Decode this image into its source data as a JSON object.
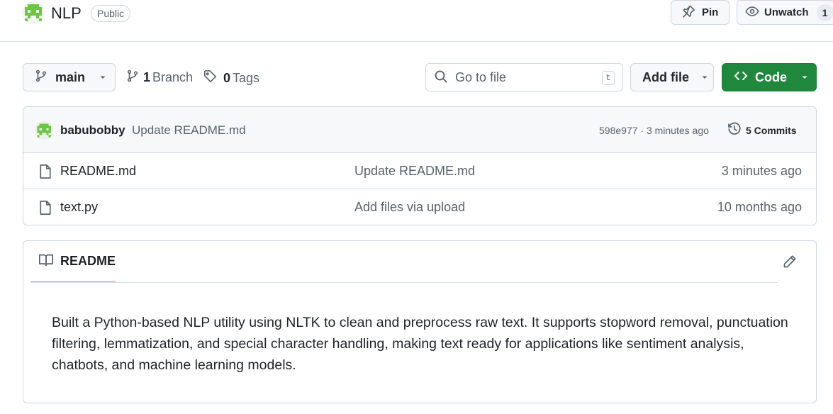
{
  "repo": {
    "name": "NLP",
    "visibility": "Public"
  },
  "actions": {
    "pin_label": "Pin",
    "watch_label": "Unwatch",
    "watch_count": "1"
  },
  "toolbar": {
    "branch": "main",
    "branches_count": "1",
    "branches_label": "Branch",
    "tags_count": "0",
    "tags_label": "Tags",
    "search_placeholder": "Go to file",
    "search_shortcut": "t",
    "add_file_label": "Add file",
    "code_label": "Code"
  },
  "latest_commit": {
    "author": "babubobby",
    "message": "Update README.md",
    "hash_time": "598e977 · 3 minutes ago",
    "commits_label": "5 Commits"
  },
  "files": [
    {
      "name": "README.md",
      "commit": "Update README.md",
      "time": "3 minutes ago"
    },
    {
      "name": "text.py",
      "commit": "Add files via upload",
      "time": "10 months ago"
    }
  ],
  "readme": {
    "tab_label": "README",
    "body": "Built a Python-based NLP utility using NLTK to clean and preprocess raw text. It supports stopword removal, punctuation filtering, lemmatization, and special character handling, making text ready for applications like sentiment analysis, chatbots, and machine learning models."
  },
  "colors": {
    "accent_green": "#1f883d",
    "avatar_green": "#6cc644",
    "tab_underline": "#fd8c73"
  },
  "icons": [
    "pin-icon",
    "eye-icon",
    "git-branch-icon",
    "tag-icon",
    "search-icon",
    "code-icon",
    "history-icon",
    "file-icon",
    "book-icon",
    "pencil-icon",
    "chevron-down-icon"
  ]
}
